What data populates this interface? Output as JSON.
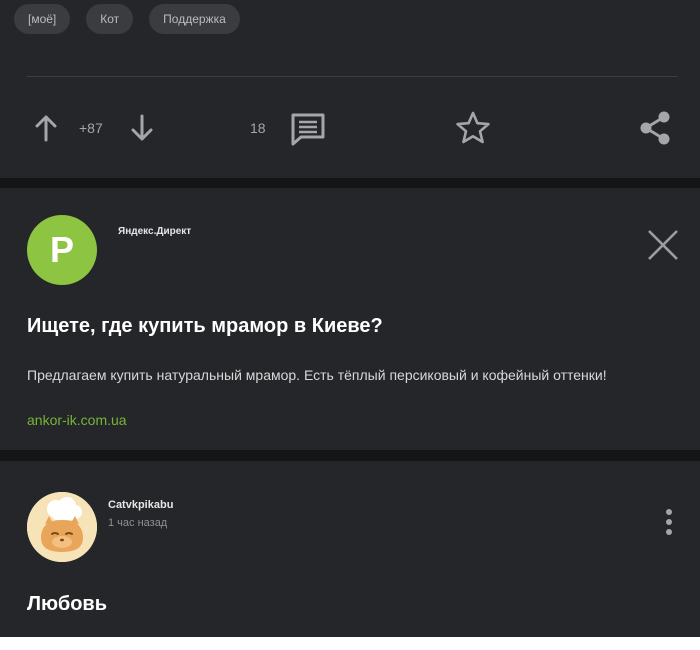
{
  "tags": [
    "[моё]",
    "Кот",
    "Поддержка"
  ],
  "actions": {
    "rating": "+87",
    "comments_count": "18",
    "icons": [
      "arrow-up-icon",
      "arrow-down-icon",
      "comment-icon",
      "star-icon",
      "share-icon"
    ]
  },
  "ad": {
    "avatar_letter": "P",
    "source": "Яндекс.Директ",
    "title": "Ищете, где купить мрамор в Киеве?",
    "text": "Предлагаем купить натуральный мрамор. Есть тёплый персиковый и кофейный оттенки!",
    "link": "ankor-ik.com.ua",
    "accent_color": "#8dc442"
  },
  "post": {
    "author": "Catvkpikabu",
    "time": "1 час назад",
    "title": "Любовь"
  },
  "colors": {
    "background": "#141517",
    "card": "#252629",
    "link": "#79b33a"
  }
}
